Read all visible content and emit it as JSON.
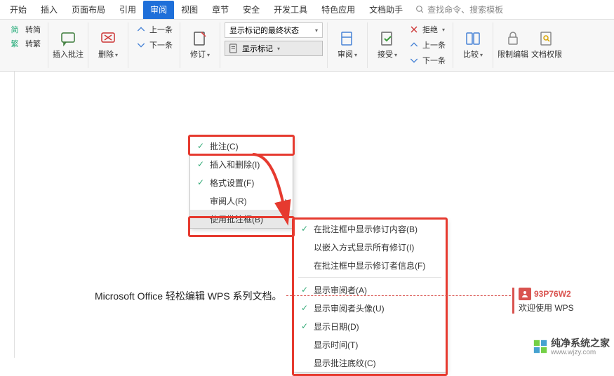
{
  "tabs": {
    "items": [
      "开始",
      "插入",
      "页面布局",
      "引用",
      "审阅",
      "视图",
      "章节",
      "安全",
      "开发工具",
      "特色应用",
      "文档助手"
    ],
    "active_index": 4,
    "search_placeholder": "查找命令、搜索模板"
  },
  "ribbon": {
    "convert": {
      "a": "转简",
      "b": "转繁"
    },
    "insert_comment": "插入批注",
    "delete": "删除",
    "prev": "上一条",
    "next": "下一条",
    "track": "修订",
    "display_mode_combo": "显示标记的最终状态",
    "show_markup": "显示标记",
    "review": "审阅",
    "accept": "接受",
    "reject": "拒绝",
    "prev2": "上一条",
    "next2": "下一条",
    "compare": "比较",
    "restrict": "限制编辑",
    "permissions": "文档权限"
  },
  "menu1": {
    "items": [
      {
        "check": true,
        "label": "批注(C)"
      },
      {
        "check": true,
        "label": "插入和删除(I)"
      },
      {
        "check": true,
        "label": "格式设置(F)"
      },
      {
        "check": false,
        "label": "审阅人(R)",
        "sub": true
      },
      {
        "check": false,
        "label": "使用批注框(B)",
        "sub": true,
        "hover": true
      }
    ]
  },
  "menu2": {
    "items": [
      {
        "check": true,
        "label": "在批注框中显示修订内容(B)"
      },
      {
        "check": false,
        "label": "以嵌入方式显示所有修订(I)"
      },
      {
        "check": false,
        "label": "在批注框中显示修订者信息(F)"
      },
      {
        "check": true,
        "label": "显示审阅者(A)"
      },
      {
        "check": true,
        "label": "显示审阅者头像(U)"
      },
      {
        "check": true,
        "label": "显示日期(D)"
      },
      {
        "check": false,
        "label": "显示时间(T)"
      },
      {
        "check": false,
        "label": "显示批注底纹(C)"
      }
    ]
  },
  "doc": {
    "body_text": "Microsoft Office 轻松编辑 WPS 系列文档。"
  },
  "comment": {
    "author": "93P76W2",
    "text": "欢迎使用 WPS"
  },
  "watermark": {
    "title": "纯净系统之家",
    "url": "www.wjzy.com"
  },
  "colors": {
    "accent": "#1e6fd9",
    "danger": "#e63a2f",
    "comment": "#d9534f"
  }
}
